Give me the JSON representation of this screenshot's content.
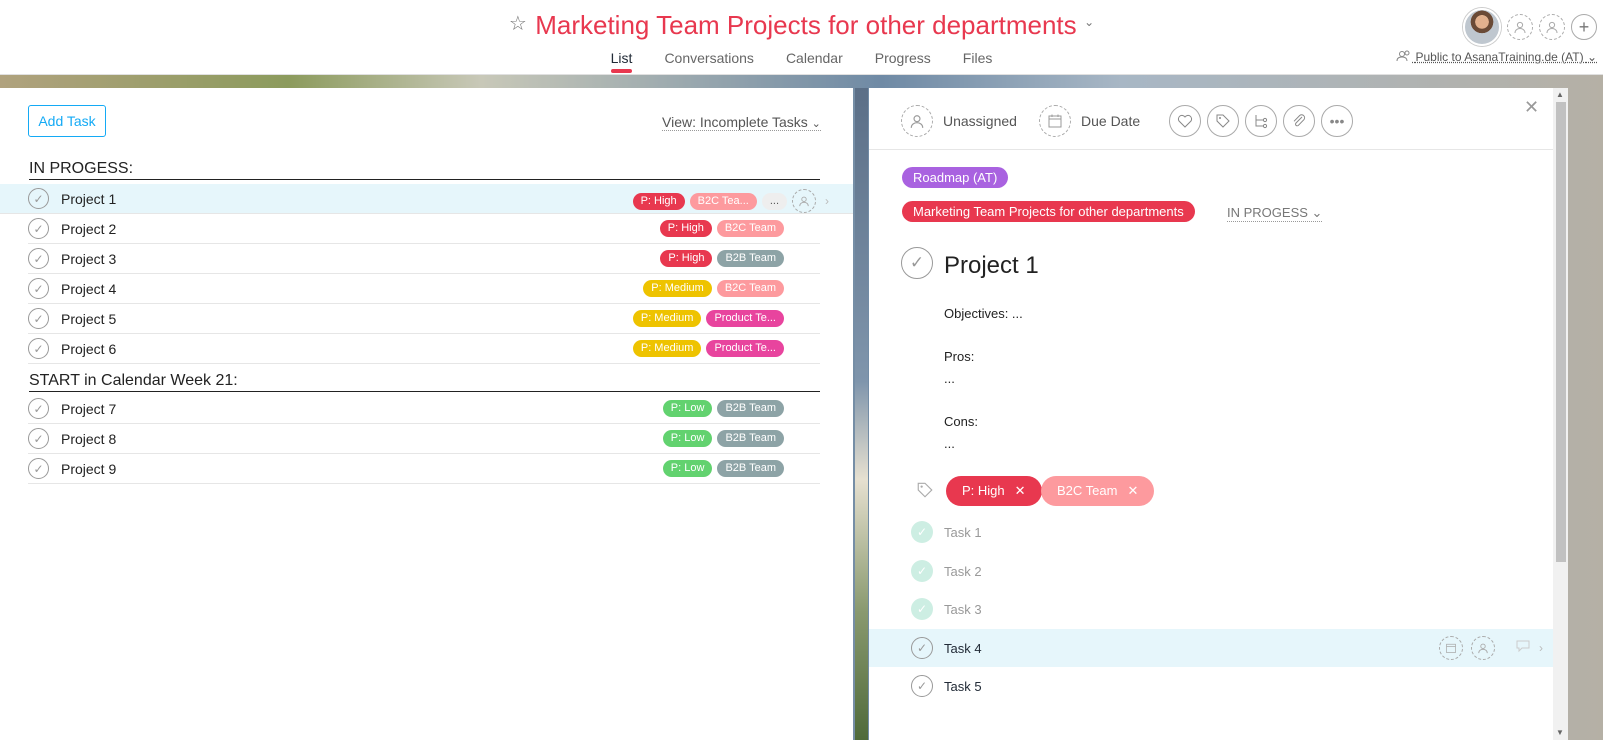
{
  "header": {
    "title": "Marketing Team Projects for other departments",
    "tabs": [
      "List",
      "Conversations",
      "Calendar",
      "Progress",
      "Files"
    ],
    "active_tab": "List",
    "visibility": "Public to AsanaTraining.de (AT)"
  },
  "list": {
    "add_task_label": "Add Task",
    "view_label": "View: Incomplete Tasks",
    "sections": [
      {
        "title": "IN PROGESS:",
        "tasks": [
          {
            "name": "Project 1",
            "tags": [
              {
                "label": "P: High",
                "kind": "high"
              },
              {
                "label": "B2C Tea...",
                "kind": "b2c"
              },
              {
                "label": "...",
                "kind": "more"
              }
            ]
          },
          {
            "name": "Project 2",
            "tags": [
              {
                "label": "P: High",
                "kind": "high"
              },
              {
                "label": "B2C Team",
                "kind": "b2c"
              }
            ]
          },
          {
            "name": "Project 3",
            "tags": [
              {
                "label": "P: High",
                "kind": "high"
              },
              {
                "label": "B2B Team",
                "kind": "b2b"
              }
            ]
          },
          {
            "name": "Project 4",
            "tags": [
              {
                "label": "P: Medium",
                "kind": "medium"
              },
              {
                "label": "B2C Team",
                "kind": "b2c"
              }
            ]
          },
          {
            "name": "Project 5",
            "tags": [
              {
                "label": "P: Medium",
                "kind": "medium"
              },
              {
                "label": "Product Te...",
                "kind": "product"
              }
            ]
          },
          {
            "name": "Project 6",
            "tags": [
              {
                "label": "P: Medium",
                "kind": "medium"
              },
              {
                "label": "Product Te...",
                "kind": "product"
              }
            ]
          }
        ]
      },
      {
        "title": "START in Calendar Week 21:",
        "tasks": [
          {
            "name": "Project 7",
            "tags": [
              {
                "label": "P: Low",
                "kind": "low"
              },
              {
                "label": "B2B Team",
                "kind": "b2b"
              }
            ]
          },
          {
            "name": "Project 8",
            "tags": [
              {
                "label": "P: Low",
                "kind": "low"
              },
              {
                "label": "B2B Team",
                "kind": "b2b"
              }
            ]
          },
          {
            "name": "Project 9",
            "tags": [
              {
                "label": "P: Low",
                "kind": "low"
              },
              {
                "label": "B2B Team",
                "kind": "b2b"
              }
            ]
          }
        ]
      }
    ]
  },
  "detail": {
    "assignee": "Unassigned",
    "due_date": "Due Date",
    "projects": [
      {
        "label": "Roadmap (AT)",
        "color": "#a962e0"
      },
      {
        "label": "Marketing Team Projects for other departments",
        "color": "#e8384f"
      }
    ],
    "section_status": "IN PROGESS",
    "task_title": "Project 1",
    "description": {
      "objectives": "Objectives: ...",
      "pros_label": "Pros:",
      "pros_value": "...",
      "cons_label": "Cons:",
      "cons_value": "..."
    },
    "tags": [
      {
        "label": "P: High",
        "color": "#e8384f"
      },
      {
        "label": "B2C Team",
        "color": "#fd9a9e"
      }
    ],
    "subtasks": [
      {
        "name": "Task 1",
        "done": true
      },
      {
        "name": "Task 2",
        "done": true
      },
      {
        "name": "Task 3",
        "done": true
      },
      {
        "name": "Task 4",
        "done": false
      },
      {
        "name": "Task 5",
        "done": false
      }
    ]
  },
  "colors": {
    "accent_red": "#e8384f",
    "accent_blue": "#14aaf5",
    "selected_row": "#e6f6fb"
  }
}
